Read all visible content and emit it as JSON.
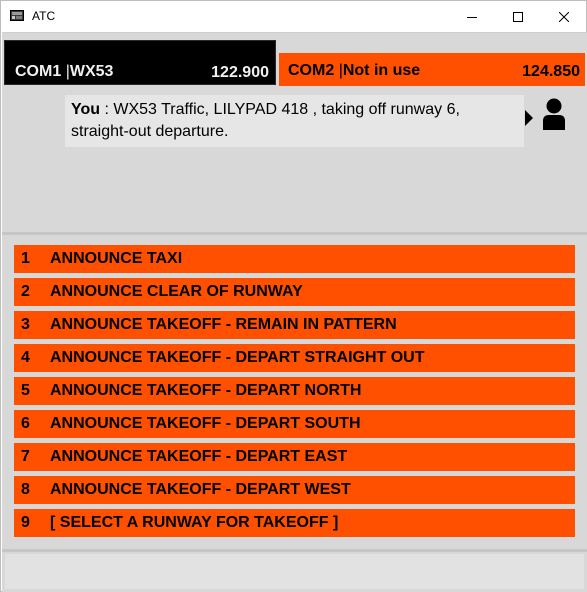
{
  "window": {
    "title": "ATC"
  },
  "com1": {
    "label": "COM1",
    "callsign": "WX53",
    "frequency": "122.900"
  },
  "com2": {
    "label": "COM2",
    "status": "Not in use",
    "frequency": "124.850"
  },
  "message": {
    "speaker": "You",
    "separator": " : ",
    "text": "WX53 Traffic, LILYPAD 418 , taking off runway 6, straight-out departure."
  },
  "menu": {
    "items": [
      {
        "num": "1",
        "label": "ANNOUNCE TAXI"
      },
      {
        "num": "2",
        "label": "ANNOUNCE CLEAR OF RUNWAY"
      },
      {
        "num": "3",
        "label": "ANNOUNCE TAKEOFF - REMAIN IN PATTERN"
      },
      {
        "num": "4",
        "label": "ANNOUNCE TAKEOFF - DEPART STRAIGHT OUT"
      },
      {
        "num": "5",
        "label": "ANNOUNCE TAKEOFF - DEPART NORTH"
      },
      {
        "num": "6",
        "label": "ANNOUNCE TAKEOFF - DEPART SOUTH"
      },
      {
        "num": "7",
        "label": "ANNOUNCE TAKEOFF - DEPART EAST"
      },
      {
        "num": "8",
        "label": "ANNOUNCE TAKEOFF - DEPART WEST"
      },
      {
        "num": "9",
        "label": "[ SELECT A RUNWAY FOR TAKEOFF ]"
      }
    ]
  },
  "colors": {
    "accent": "#ff5000",
    "com1_bg": "#000000",
    "client_bg": "#d8d8d8"
  }
}
